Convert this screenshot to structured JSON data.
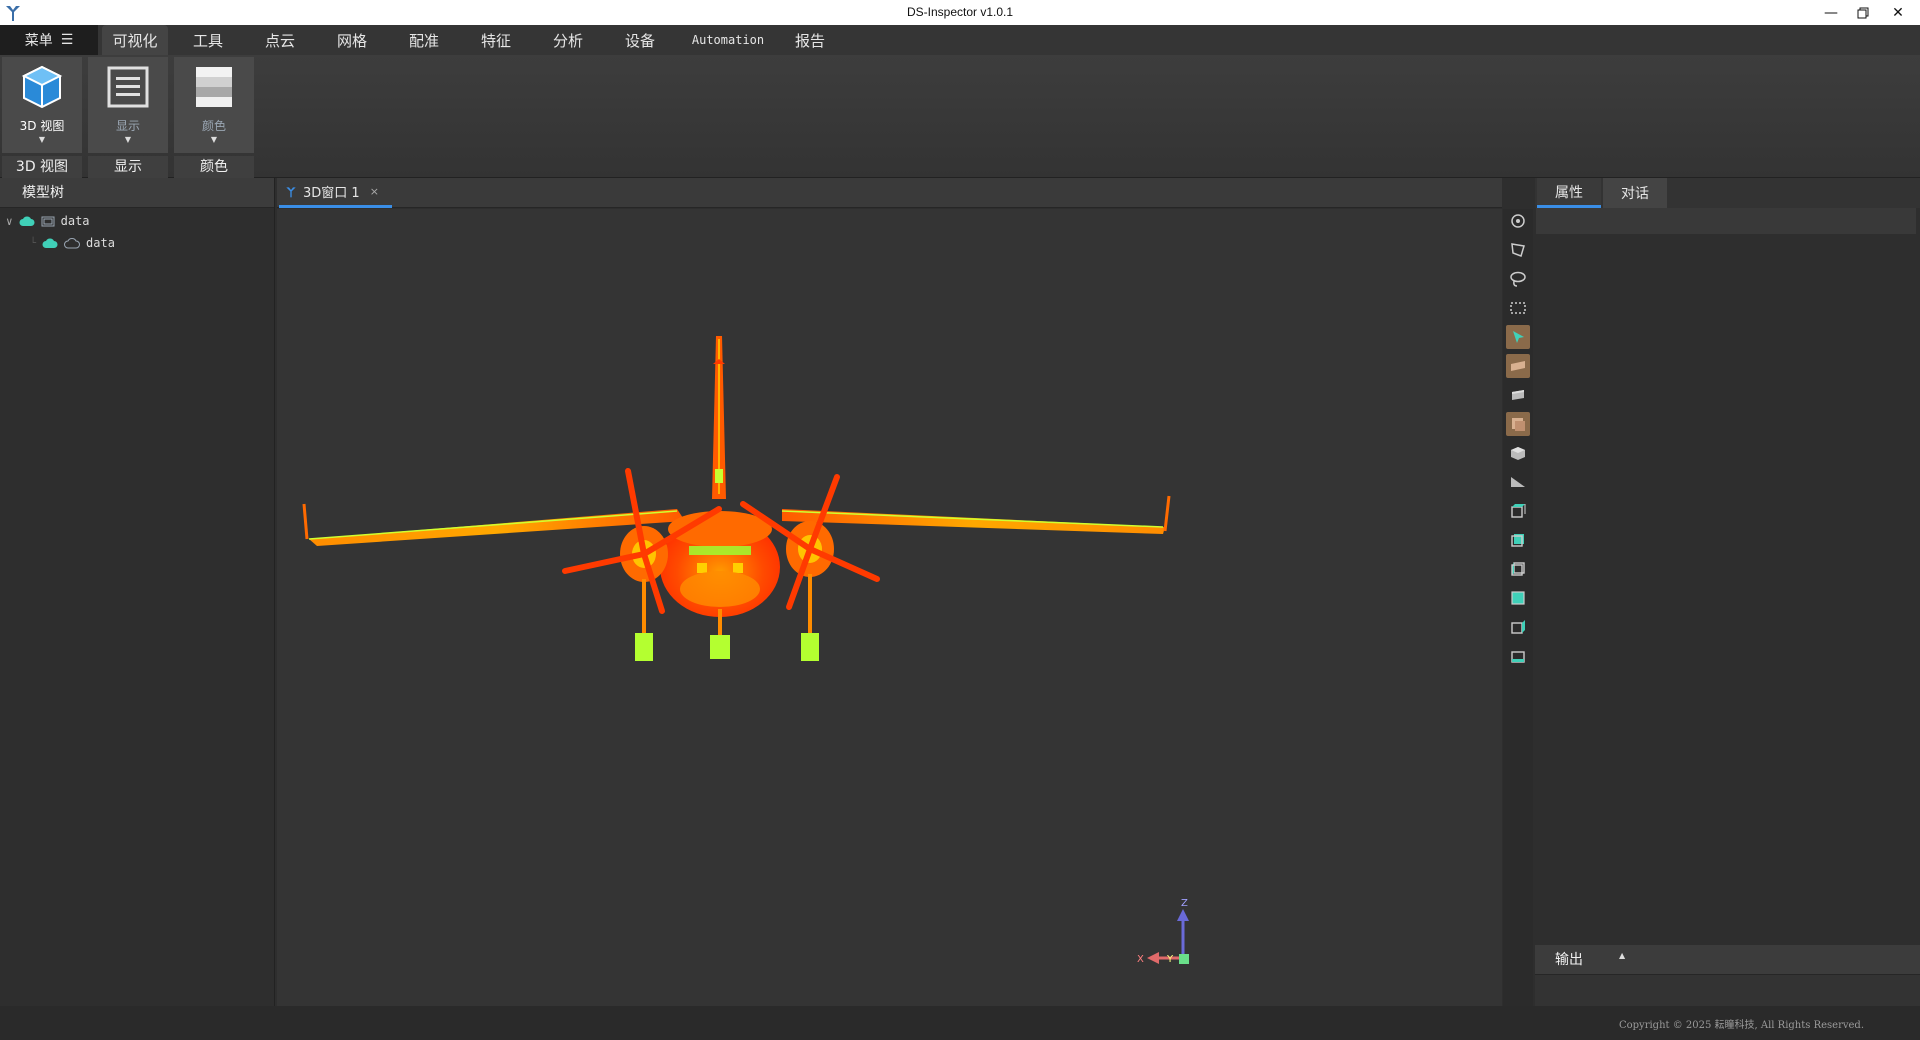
{
  "window": {
    "title": "DS-Inspector v1.0.1"
  },
  "menubar": {
    "menu_label": "菜单",
    "items": [
      "可视化",
      "工具",
      "点云",
      "网格",
      "配准",
      "特征",
      "分析",
      "设备",
      "Automation",
      "报告"
    ],
    "active": "可视化"
  },
  "ribbon": {
    "groups": [
      {
        "button": "3D 视图",
        "icon": "cube-icon",
        "group": "3D 视图"
      },
      {
        "button": "显示",
        "icon": "list-display-icon",
        "group": "显示"
      },
      {
        "button": "颜色",
        "icon": "color-gradient-icon",
        "group": "颜色"
      }
    ]
  },
  "model_tree": {
    "title": "模型树",
    "items": [
      {
        "label": "data",
        "level": 0
      },
      {
        "label": "data",
        "level": 1
      }
    ]
  },
  "view": {
    "tab_label": "3D窗口 1",
    "close": "×",
    "axes": {
      "x": "X",
      "y": "Y",
      "z": "Z"
    }
  },
  "viewport_toolbar": [
    "zoom-fit-icon",
    "polygon-select-icon",
    "lasso-select-icon",
    "rect-select-icon",
    "pointer-icon",
    "plane-section-icon",
    "box-section-icon",
    "cube-face-icon",
    "cube-iso-icon",
    "plane-tilt-icon",
    "view-front-icon",
    "view-back-icon",
    "view-left-icon",
    "view-right-icon",
    "view-top-icon",
    "view-bottom-icon"
  ],
  "right_panel": {
    "tabs": [
      "属性",
      "对话"
    ],
    "active_tab": "属性",
    "output_label": "输出"
  },
  "status": {
    "copyright": "Copyright © 2025 耘瞳科技, All Rights Reserved."
  },
  "colors": {
    "accent": "#3a8ee6",
    "teal": "#40d0b8",
    "cloud_hot": "#ff3a00",
    "cloud_mid": "#ff8c00",
    "cloud_low": "#c8ff00"
  }
}
